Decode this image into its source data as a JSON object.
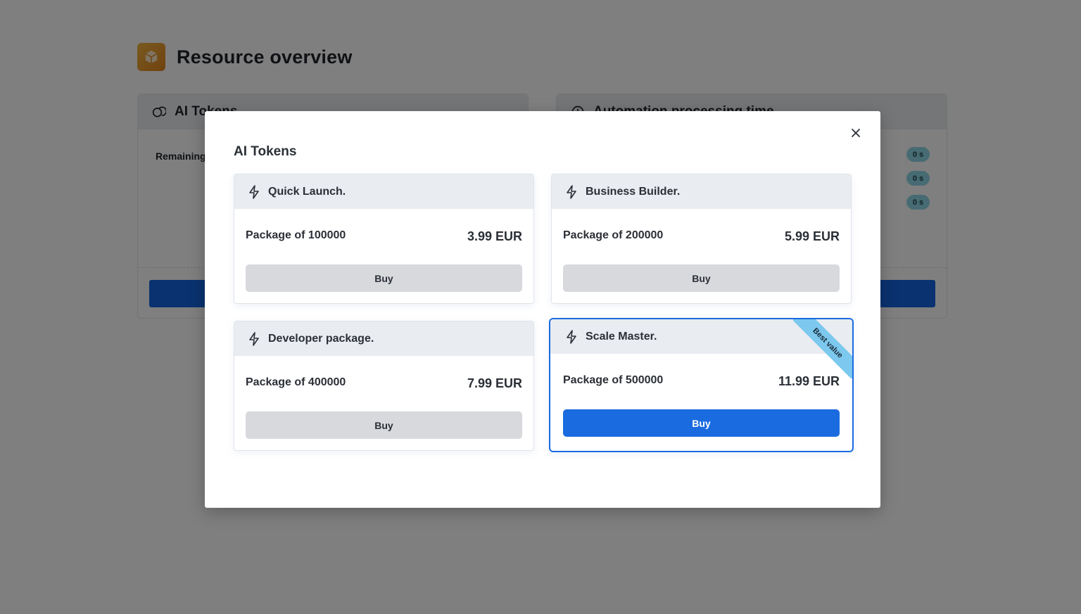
{
  "page": {
    "title": "Resource overview",
    "cards": [
      {
        "title": "AI Tokens",
        "row_label": "Remaining"
      },
      {
        "title": "Automation processing time",
        "pills": [
          "0 s",
          "0 s",
          "0 s"
        ]
      }
    ]
  },
  "modal": {
    "title": "AI Tokens",
    "close_icon": "close-icon",
    "packages": [
      {
        "name": "Quick Launch.",
        "description": "Package of 100000",
        "price": "3.99 EUR",
        "buy_label": "Buy",
        "icon": "lightning-icon"
      },
      {
        "name": "Business Builder.",
        "description": "Package of 200000",
        "price": "5.99 EUR",
        "buy_label": "Buy",
        "icon": "lightning-icon"
      },
      {
        "name": "Developer package.",
        "description": "Package of 400000",
        "price": "7.99 EUR",
        "buy_label": "Buy",
        "icon": "lightning-icon"
      },
      {
        "name": "Scale Master.",
        "description": "Package of 500000",
        "price": "11.99 EUR",
        "buy_label": "Buy",
        "icon": "lightning-icon",
        "badge": "Best value"
      }
    ]
  },
  "colors": {
    "primary": "#1a6be0",
    "ribbon": "#7cc8ee",
    "overlay": "rgba(0,0,0,0.5)"
  }
}
